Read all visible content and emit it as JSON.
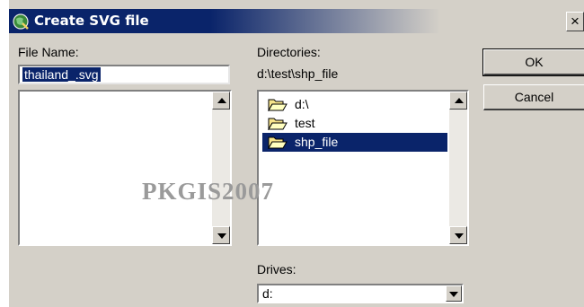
{
  "window": {
    "title": "Create SVG file",
    "close_glyph": "×"
  },
  "file_name": {
    "label": "File Name:",
    "value": "thailand_.svg"
  },
  "directories": {
    "label": "Directories:",
    "current_path": "d:\\test\\shp_file",
    "items": [
      {
        "label": "d:\\",
        "icon": "open-folder-icon",
        "selected": false
      },
      {
        "label": "test",
        "icon": "open-folder-icon",
        "selected": false
      },
      {
        "label": "shp_file",
        "icon": "open-folder-icon",
        "selected": true
      }
    ]
  },
  "drives": {
    "label": "Drives:",
    "selected": "d:"
  },
  "buttons": {
    "ok": "OK",
    "cancel": "Cancel"
  },
  "watermark": "PKGIS2007",
  "colors": {
    "title_bar": "#0a246a",
    "selection": "#0a246a",
    "face": "#d4d0c8",
    "watermark": "#9a9a9a"
  }
}
